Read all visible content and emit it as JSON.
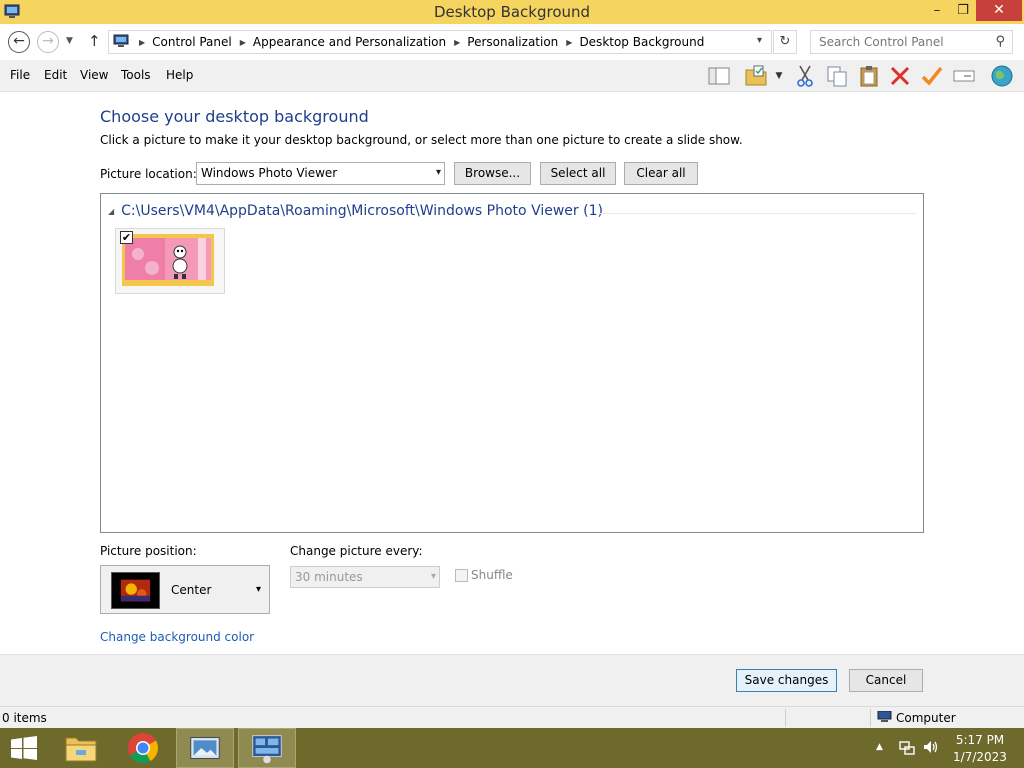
{
  "window": {
    "title": "Desktop Background",
    "minimize_glyph": "–",
    "maximize_glyph": "❐",
    "close_glyph": "✕"
  },
  "address": {
    "crumbs": [
      "Control Panel",
      "Appearance and Personalization",
      "Personalization",
      "Desktop Background"
    ],
    "search_placeholder": "Search Control Panel"
  },
  "menu": {
    "items": [
      "File",
      "Edit",
      "View",
      "Tools",
      "Help"
    ],
    "toolbar_icons": [
      "layout-icon",
      "properties-folder-icon",
      "cut-icon",
      "copy-icon",
      "paste-icon",
      "delete-icon",
      "check-icon",
      "rename-icon",
      "globe-icon"
    ]
  },
  "main": {
    "heading": "Choose your desktop background",
    "description": "Click a picture to make it your desktop background, or select more than one picture to create a slide show.",
    "location_label": "Picture location:",
    "location_value": "Windows Photo Viewer",
    "browse_label": "Browse...",
    "select_all_label": "Select all",
    "clear_all_label": "Clear all",
    "group_path": "C:\\Users\\VM4\\AppData\\Roaming\\Microsoft\\Windows Photo Viewer (1)",
    "thumbnail_checked": true,
    "position_label": "Picture position:",
    "position_value": "Center",
    "change_label": "Change picture every:",
    "change_value": "30 minutes",
    "shuffle_label": "Shuffle",
    "bg_color_link": "Change background color"
  },
  "footer": {
    "save_label": "Save changes",
    "cancel_label": "Cancel"
  },
  "status": {
    "items": "0 items",
    "location": "Computer"
  },
  "taskbar": {
    "time": "5:17 PM",
    "date": "1/7/2023"
  },
  "colors": {
    "titlebar": "#f5d55f",
    "taskbar": "#6e6a2c",
    "heading": "#1f3f8c",
    "link": "#1e5bb5",
    "close": "#c7413a"
  }
}
